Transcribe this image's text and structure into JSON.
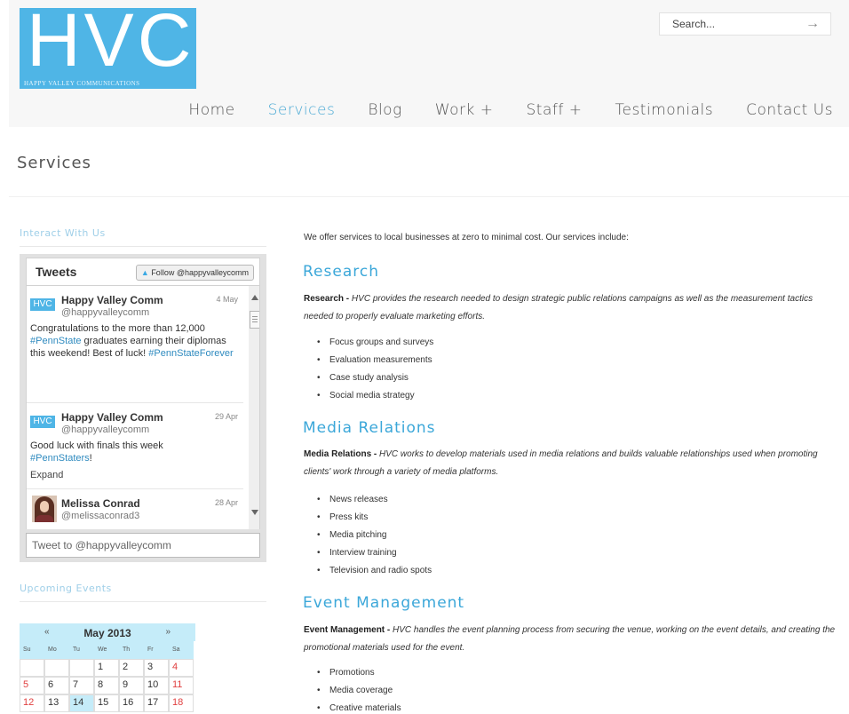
{
  "logo": {
    "big": "HVC",
    "small": "HAPPY VALLEY COMMUNICATIONS"
  },
  "search": {
    "placeholder": "Search...",
    "button": "→"
  },
  "nav": [
    "Home",
    "Services",
    "Blog",
    "Work +",
    "Staff +",
    "Testimonials",
    "Contact Us"
  ],
  "nav_active": "Services",
  "page_title": "Services",
  "sidebar": {
    "interact_heading": "Interact With Us",
    "events_heading": "Upcoming Events"
  },
  "twitter": {
    "title": "Tweets",
    "follow": "Follow @happyvalleycomm",
    "tweets": [
      {
        "avatar": "HVC",
        "name": "Happy Valley Comm",
        "handle": "@happyvalleycomm",
        "date": "4 May",
        "text_parts": [
          "Congratulations to the more than 12,000 ",
          "#PennState",
          " graduates earning their diplomas this weekend! Best of luck! ",
          "#PennStateForever"
        ]
      },
      {
        "avatar": "HVC",
        "name": "Happy Valley Comm",
        "handle": "@happyvalleycomm",
        "date": "29 Apr",
        "text_parts": [
          "Good luck with finals this week ",
          "#PennStaters",
          "!"
        ],
        "expand": "Expand"
      },
      {
        "name": "Melissa Conrad",
        "handle": "@melissaconrad3",
        "date": "28 Apr"
      }
    ],
    "input_placeholder": "Tweet to @happyvalleycomm"
  },
  "calendar": {
    "prev": "«",
    "next": "»",
    "title": "May 2013",
    "days": [
      "Su",
      "Mo",
      "Tu",
      "We",
      "Th",
      "Fr",
      "Sa"
    ],
    "weeks": [
      [
        "",
        "",
        "",
        "1",
        "2",
        "3",
        "4"
      ],
      [
        "5",
        "6",
        "7",
        "8",
        "9",
        "10",
        "11"
      ],
      [
        "12",
        "13",
        "14",
        "15",
        "16",
        "17",
        "18"
      ]
    ],
    "today": "14"
  },
  "content": {
    "intro": "We offer services to local businesses at zero to minimal cost. Our services include:",
    "sections": [
      {
        "heading": "Research",
        "lead": "Research - ",
        "text": "HVC provides the research needed to design strategic public relations campaigns as well as the measurement tactics needed to properly evaluate marketing efforts.",
        "items": [
          "Focus groups and surveys",
          "Evaluation measurements",
          "Case study analysis",
          "Social media strategy"
        ]
      },
      {
        "heading": "Media Relations",
        "lead": "Media Relations - ",
        "text": "HVC works to develop materials used in media relations and builds valuable relationships used when promoting clients' work through a variety of media platforms.",
        "items": [
          "News releases",
          "Press kits",
          "Media pitching",
          "Interview training",
          "Television and radio spots"
        ]
      },
      {
        "heading": "Event Management",
        "lead": "Event Management - ",
        "text": "HVC handles the event planning process from securing the venue, working on the event details, and creating the promotional materials used for the event.",
        "items": [
          "Promotions",
          "Media coverage",
          "Creative materials"
        ]
      }
    ]
  },
  "colors": {
    "brand": "#4fb5e6",
    "accent": "#3ba7d9",
    "calendar": "#c5ecf9",
    "weekend": "#e04040"
  }
}
